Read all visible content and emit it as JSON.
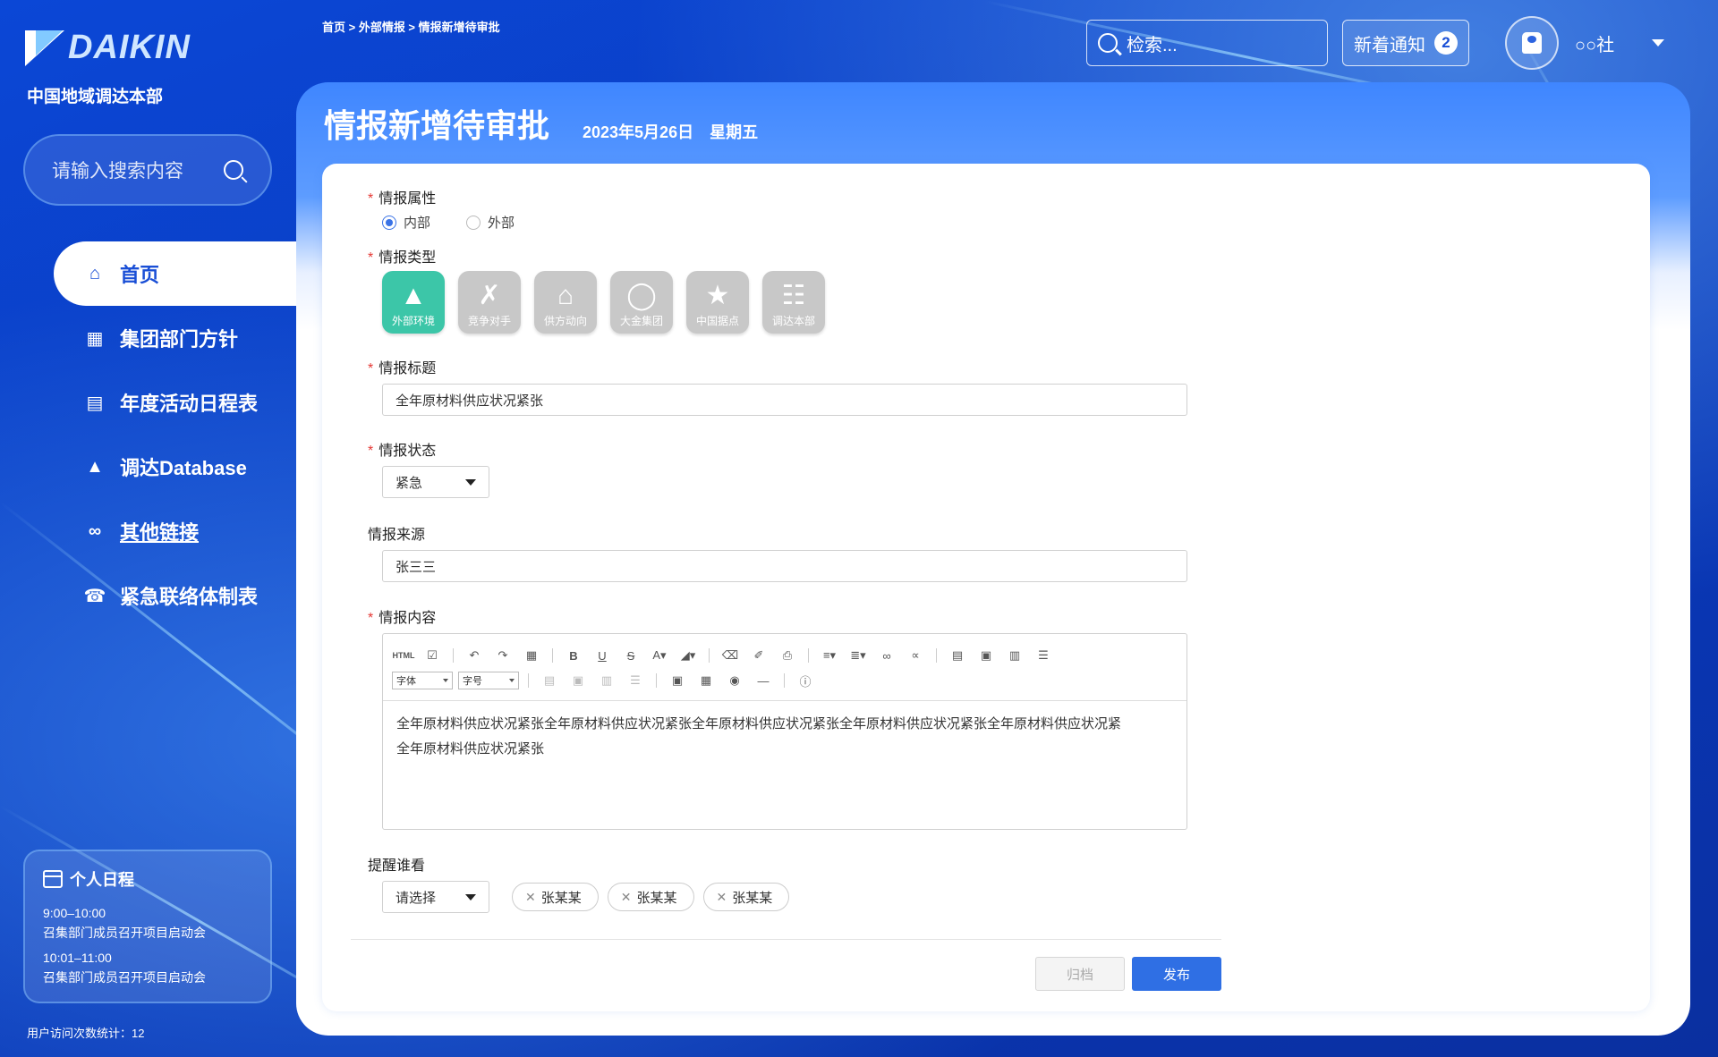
{
  "brand": {
    "logo_text": "DAIKIN",
    "org_name": "中国地域调达本部"
  },
  "sidebar": {
    "search_placeholder": "请输入搜索内容",
    "items": [
      {
        "label": "首页",
        "icon": "home-icon",
        "active": true
      },
      {
        "label": "集团部门方针",
        "icon": "building-icon"
      },
      {
        "label": "年度活动日程表",
        "icon": "calendar-icon"
      },
      {
        "label": "调达Database",
        "icon": "chart-icon"
      },
      {
        "label": "其他链接",
        "icon": "link-icon"
      },
      {
        "label": "紧急联络体制表",
        "icon": "phone-icon"
      }
    ],
    "schedule": {
      "title": "个人日程",
      "events": [
        {
          "time": "9:00–10:00",
          "desc": "召集部门成员召开项目启动会"
        },
        {
          "time": "10:01–11:00",
          "desc": "召集部门成员召开项目启动会"
        }
      ]
    },
    "visit_count": "用户访问次数统计：12"
  },
  "header": {
    "breadcrumb": "首页 > 外部情报 > 情报新增待审批",
    "search_placeholder": "检索...",
    "notify_label": "新着通知",
    "notify_count": "2",
    "user_name": "○○社"
  },
  "page": {
    "title": "情报新增待审批",
    "date": "2023年5月26日　星期五"
  },
  "form": {
    "attr_label": "情报属性",
    "attr_options": [
      {
        "label": "内部",
        "checked": true
      },
      {
        "label": "外部",
        "checked": false
      }
    ],
    "type_label": "情报类型",
    "types": [
      {
        "label": "外部环境",
        "icon": "tree-icon",
        "selected": true
      },
      {
        "label": "竞争对手",
        "icon": "swords-icon"
      },
      {
        "label": "供方动向",
        "icon": "factory-icon"
      },
      {
        "label": "大金集团",
        "icon": "globe-icon"
      },
      {
        "label": "中国据点",
        "icon": "star-icon"
      },
      {
        "label": "调达本部",
        "icon": "org-chart-icon"
      }
    ],
    "title_label": "情报标题",
    "title_value": "全年原材料供应状况紧张",
    "status_label": "情报状态",
    "status_value": "紧急",
    "source_label": "情报来源",
    "source_value": "张三三",
    "content_label": "情报内容",
    "editor": {
      "font_select": "字体",
      "size_select": "字号",
      "html_btn": "HTML",
      "body_line1": "全年原材料供应状况紧张全年原材料供应状况紧张全年原材料供应状况紧张全年原材料供应状况紧张全年原材料供应状况紧",
      "body_line2": "全年原材料供应状况紧张"
    },
    "remind_label": "提醒谁看",
    "remind_select": "请选择",
    "chips": [
      "张某某",
      "张某某",
      "张某某"
    ],
    "archive_label": "归档",
    "publish_label": "发布"
  },
  "colors": {
    "primary": "#2f6fe4",
    "selected_type": "#3cc6a8",
    "required": "#e53935"
  }
}
